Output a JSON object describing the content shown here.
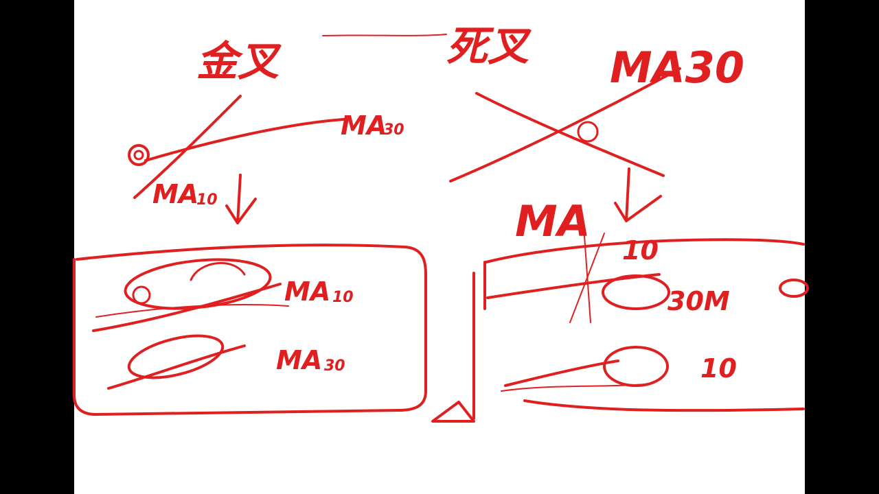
{
  "ink_color": "#e02020",
  "ghost_color": "#f1c9c9",
  "background": "#ffffff",
  "letterbox": "#000000",
  "labels": {
    "left_heading": "金叉",
    "right_heading": "死叉",
    "ma30_top_right": "MA30",
    "ma30_left_short": "MA",
    "ma30_left_sub": "30",
    "ma10_left_short": "MA",
    "ma10_left_sub": "10",
    "ma10_right_big": "MA",
    "ma10_right_sub": "10",
    "box_left_upper": "MA",
    "box_left_upper_sub": "10",
    "box_left_lower": "MA",
    "box_left_lower_sub": "30",
    "box_right_upper": "30M",
    "box_right_lower": "10"
  }
}
